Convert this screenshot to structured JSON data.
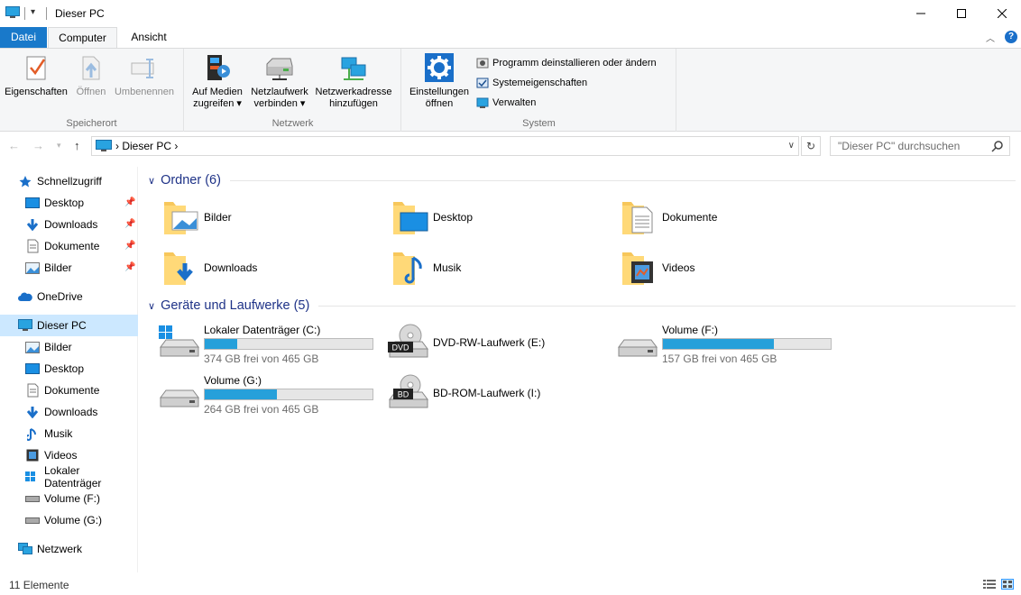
{
  "window": {
    "title": "Dieser PC"
  },
  "tabs": {
    "file": "Datei",
    "computer": "Computer",
    "view": "Ansicht"
  },
  "ribbon": {
    "location": {
      "label": "Speicherort",
      "properties": "Eigenschaften",
      "open": "Öffnen",
      "rename": "Umbenennen"
    },
    "network": {
      "label": "Netzwerk",
      "media_line1": "Auf Medien",
      "media_line2": "zugreifen",
      "drive_line1": "Netzlaufwerk",
      "drive_line2": "verbinden",
      "addr_line1": "Netzwerkadresse",
      "addr_line2": "hinzufügen"
    },
    "system": {
      "label": "System",
      "settings_line1": "Einstellungen",
      "settings_line2": "öffnen",
      "uninstall": "Programm deinstallieren oder ändern",
      "sysprops": "Systemeigenschaften",
      "manage": "Verwalten"
    }
  },
  "address": {
    "crumb": "Dieser PC"
  },
  "search": {
    "placeholder": "\"Dieser PC\" durchsuchen"
  },
  "nav": {
    "quick_access": "Schnellzugriff",
    "quick": [
      "Desktop",
      "Downloads",
      "Dokumente",
      "Bilder"
    ],
    "onedrive": "OneDrive",
    "this_pc": "Dieser PC",
    "pc_items": [
      "Bilder",
      "Desktop",
      "Dokumente",
      "Downloads",
      "Musik",
      "Videos",
      "Lokaler Datenträger",
      "Volume (F:)",
      "Volume (G:)"
    ],
    "network": "Netzwerk"
  },
  "folders": {
    "header": "Ordner (6)",
    "items": [
      "Bilder",
      "Desktop",
      "Dokumente",
      "Downloads",
      "Musik",
      "Videos"
    ]
  },
  "devices": {
    "header": "Geräte und Laufwerke (5)",
    "items": [
      {
        "name": "Lokaler Datenträger (C:)",
        "free": "374 GB frei von 465 GB",
        "used_fraction": 0.196
      },
      {
        "name": "DVD-RW-Laufwerk (E:)"
      },
      {
        "name": "Volume (F:)",
        "free": "157 GB frei von 465 GB",
        "used_fraction": 0.662
      },
      {
        "name": "Volume (G:)",
        "free": "264 GB frei von 465 GB",
        "used_fraction": 0.432
      },
      {
        "name": "BD-ROM-Laufwerk (I:)"
      }
    ],
    "dvd_badge": "DVD",
    "bd_badge": "BD"
  },
  "status": {
    "count": "11 Elemente"
  },
  "colors": {
    "accent": "#1979ca",
    "bar": "#26a0da",
    "section": "#1e3287",
    "selected": "#cce8ff"
  }
}
